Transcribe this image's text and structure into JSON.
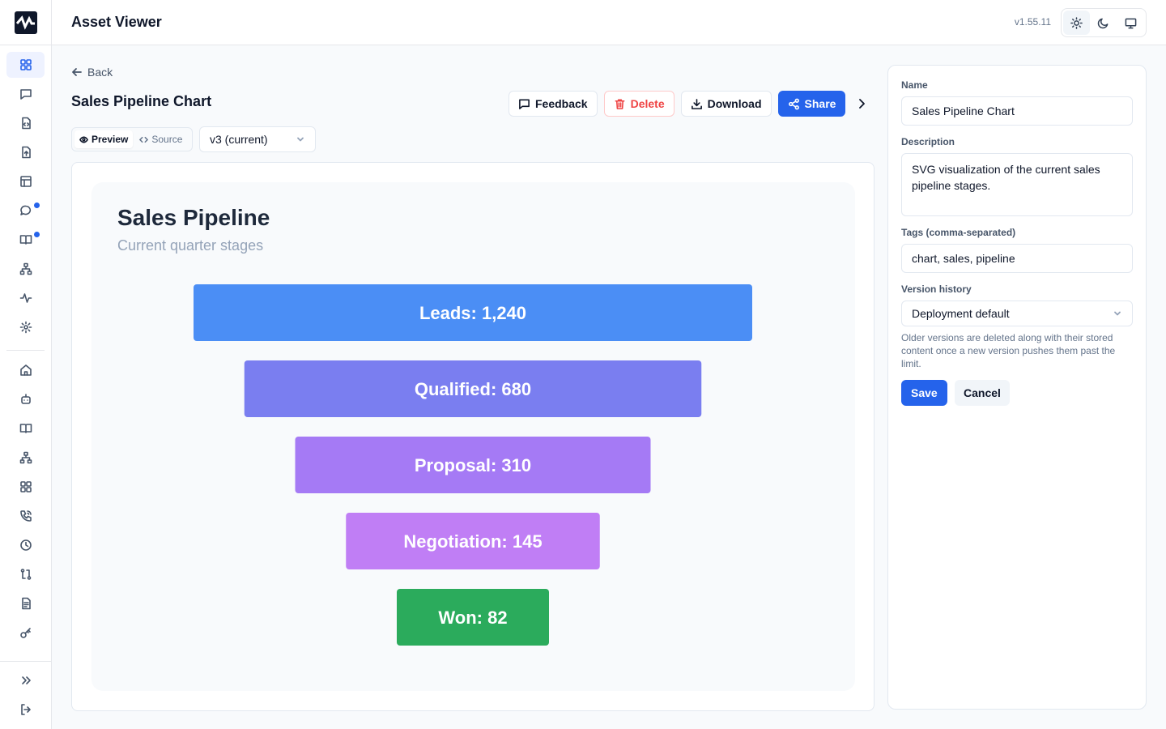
{
  "app": {
    "title": "Asset Viewer",
    "version": "v1.55.11"
  },
  "sidebar": {
    "top_items": [
      {
        "icon": "grid-icon",
        "active": true
      },
      {
        "icon": "message-square-icon"
      },
      {
        "icon": "file-code-icon"
      },
      {
        "icon": "file-upload-icon"
      },
      {
        "icon": "table-icon"
      },
      {
        "icon": "chat-bubble-icon",
        "badge": true
      },
      {
        "icon": "book-open-icon",
        "badge": true
      },
      {
        "icon": "network-icon"
      },
      {
        "icon": "activity-icon"
      },
      {
        "icon": "settings-icon"
      }
    ],
    "bottom_items": [
      {
        "icon": "home-icon"
      },
      {
        "icon": "bot-icon"
      },
      {
        "icon": "book-icon"
      },
      {
        "icon": "sitemap-icon"
      },
      {
        "icon": "apps-icon"
      },
      {
        "icon": "phone-icon"
      },
      {
        "icon": "clock-icon"
      },
      {
        "icon": "git-compare-icon"
      },
      {
        "icon": "file-text-icon"
      },
      {
        "icon": "key-icon"
      }
    ],
    "footer_items": [
      {
        "icon": "chevrons-right-icon"
      },
      {
        "icon": "logout-icon"
      }
    ]
  },
  "theme": {
    "options": [
      "light",
      "dark",
      "system"
    ],
    "selected": "light"
  },
  "main": {
    "back_label": "Back",
    "title": "Sales Pipeline Chart",
    "actions": {
      "feedback": "Feedback",
      "delete": "Delete",
      "download": "Download",
      "share": "Share"
    },
    "view_modes": {
      "preview": "Preview",
      "source": "Source",
      "selected": "preview"
    },
    "version_select": "v3 (current)"
  },
  "chart_data": {
    "type": "funnel",
    "title": "Sales Pipeline",
    "subtitle": "Current quarter stages",
    "stages": [
      {
        "name": "Leads",
        "value": 1240,
        "label": "Leads: 1,240",
        "color": "#4b8ef5"
      },
      {
        "name": "Qualified",
        "value": 680,
        "label": "Qualified: 680",
        "color": "#7a7ef0"
      },
      {
        "name": "Proposal",
        "value": 310,
        "label": "Proposal: 310",
        "color": "#a57af5"
      },
      {
        "name": "Negotiation",
        "value": 145,
        "label": "Negotiation: 145",
        "color": "#c07ef5"
      },
      {
        "name": "Won",
        "value": 82,
        "label": "Won: 82",
        "color": "#2bab5c"
      }
    ]
  },
  "panel": {
    "name_label": "Name",
    "name_value": "Sales Pipeline Chart",
    "description_label": "Description",
    "description_value": "SVG visualization of the current sales pipeline stages.",
    "tags_label": "Tags (comma-separated)",
    "tags_value": "chart, sales, pipeline",
    "version_history_label": "Version history",
    "version_history_value": "Deployment default",
    "help_text": "Older versions are deleted along with their stored content once a new version pushes them past the limit.",
    "save_label": "Save",
    "cancel_label": "Cancel"
  },
  "colors": {
    "accent": "#2563eb",
    "danger": "#ef4444"
  }
}
